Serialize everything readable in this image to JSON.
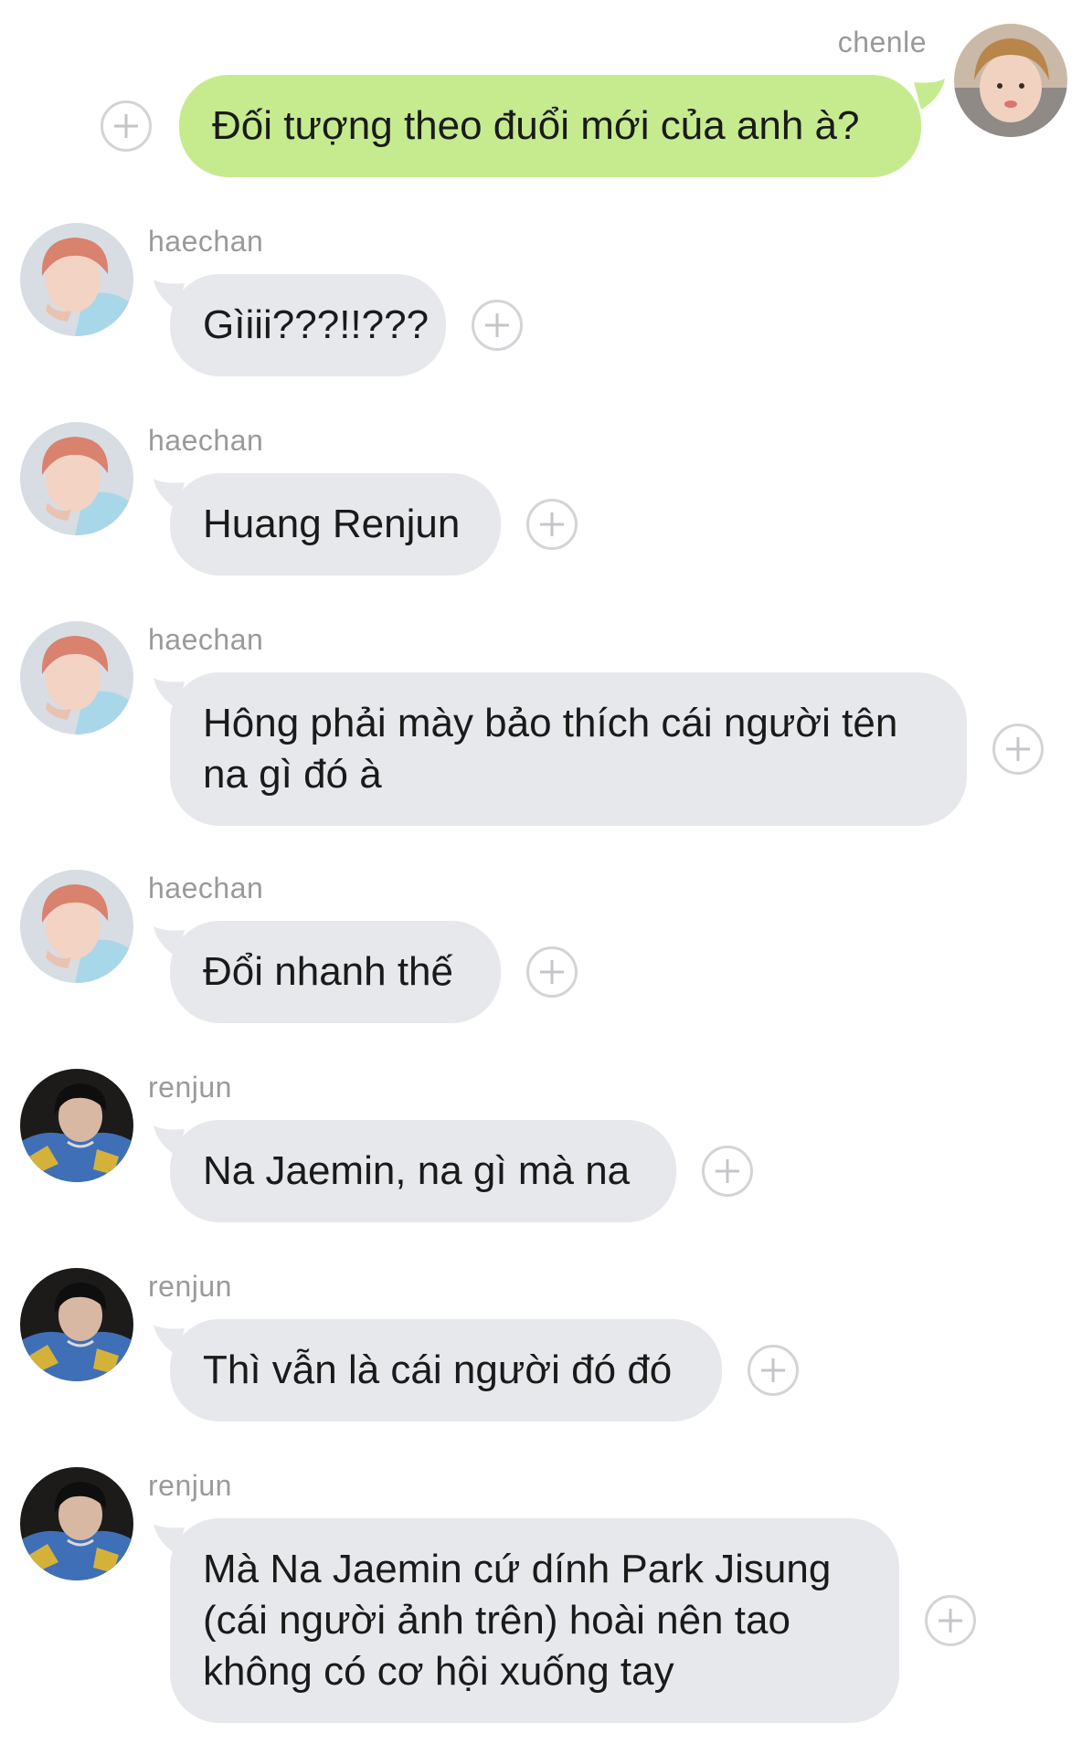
{
  "colors": {
    "background": "#ffffff",
    "incoming_bubble": "#e6e8ec",
    "outgoing_bubble": "#c6eb8f",
    "sender_name": "#9a9a9a",
    "text": "#1a1a1a"
  },
  "messages": [
    {
      "sender": "chenle",
      "direction": "outgoing",
      "text": "Đối tượng theo đuổi mới của anh à?",
      "avatar_icon": "avatar-chenle"
    },
    {
      "sender": "haechan",
      "direction": "incoming",
      "text": "Gìiii???!!???",
      "avatar_icon": "avatar-haechan"
    },
    {
      "sender": "haechan",
      "direction": "incoming",
      "text": "Huang Renjun",
      "avatar_icon": "avatar-haechan"
    },
    {
      "sender": "haechan",
      "direction": "incoming",
      "text": "Hông phải mày bảo thích cái người tên\nna gì đó à",
      "avatar_icon": "avatar-haechan"
    },
    {
      "sender": "haechan",
      "direction": "incoming",
      "text": "Đổi nhanh thế",
      "avatar_icon": "avatar-haechan"
    },
    {
      "sender": "renjun",
      "direction": "incoming",
      "text": "Na Jaemin, na gì mà na",
      "avatar_icon": "avatar-renjun"
    },
    {
      "sender": "renjun",
      "direction": "incoming",
      "text": "Thì vẫn là cái người đó đó",
      "avatar_icon": "avatar-renjun"
    },
    {
      "sender": "renjun",
      "direction": "incoming",
      "text": "Mà Na Jaemin cứ dính Park Jisung\n(cái người ảnh trên) hoài nên tao\nkhông có cơ hội xuống tay",
      "avatar_icon": "avatar-renjun"
    }
  ]
}
